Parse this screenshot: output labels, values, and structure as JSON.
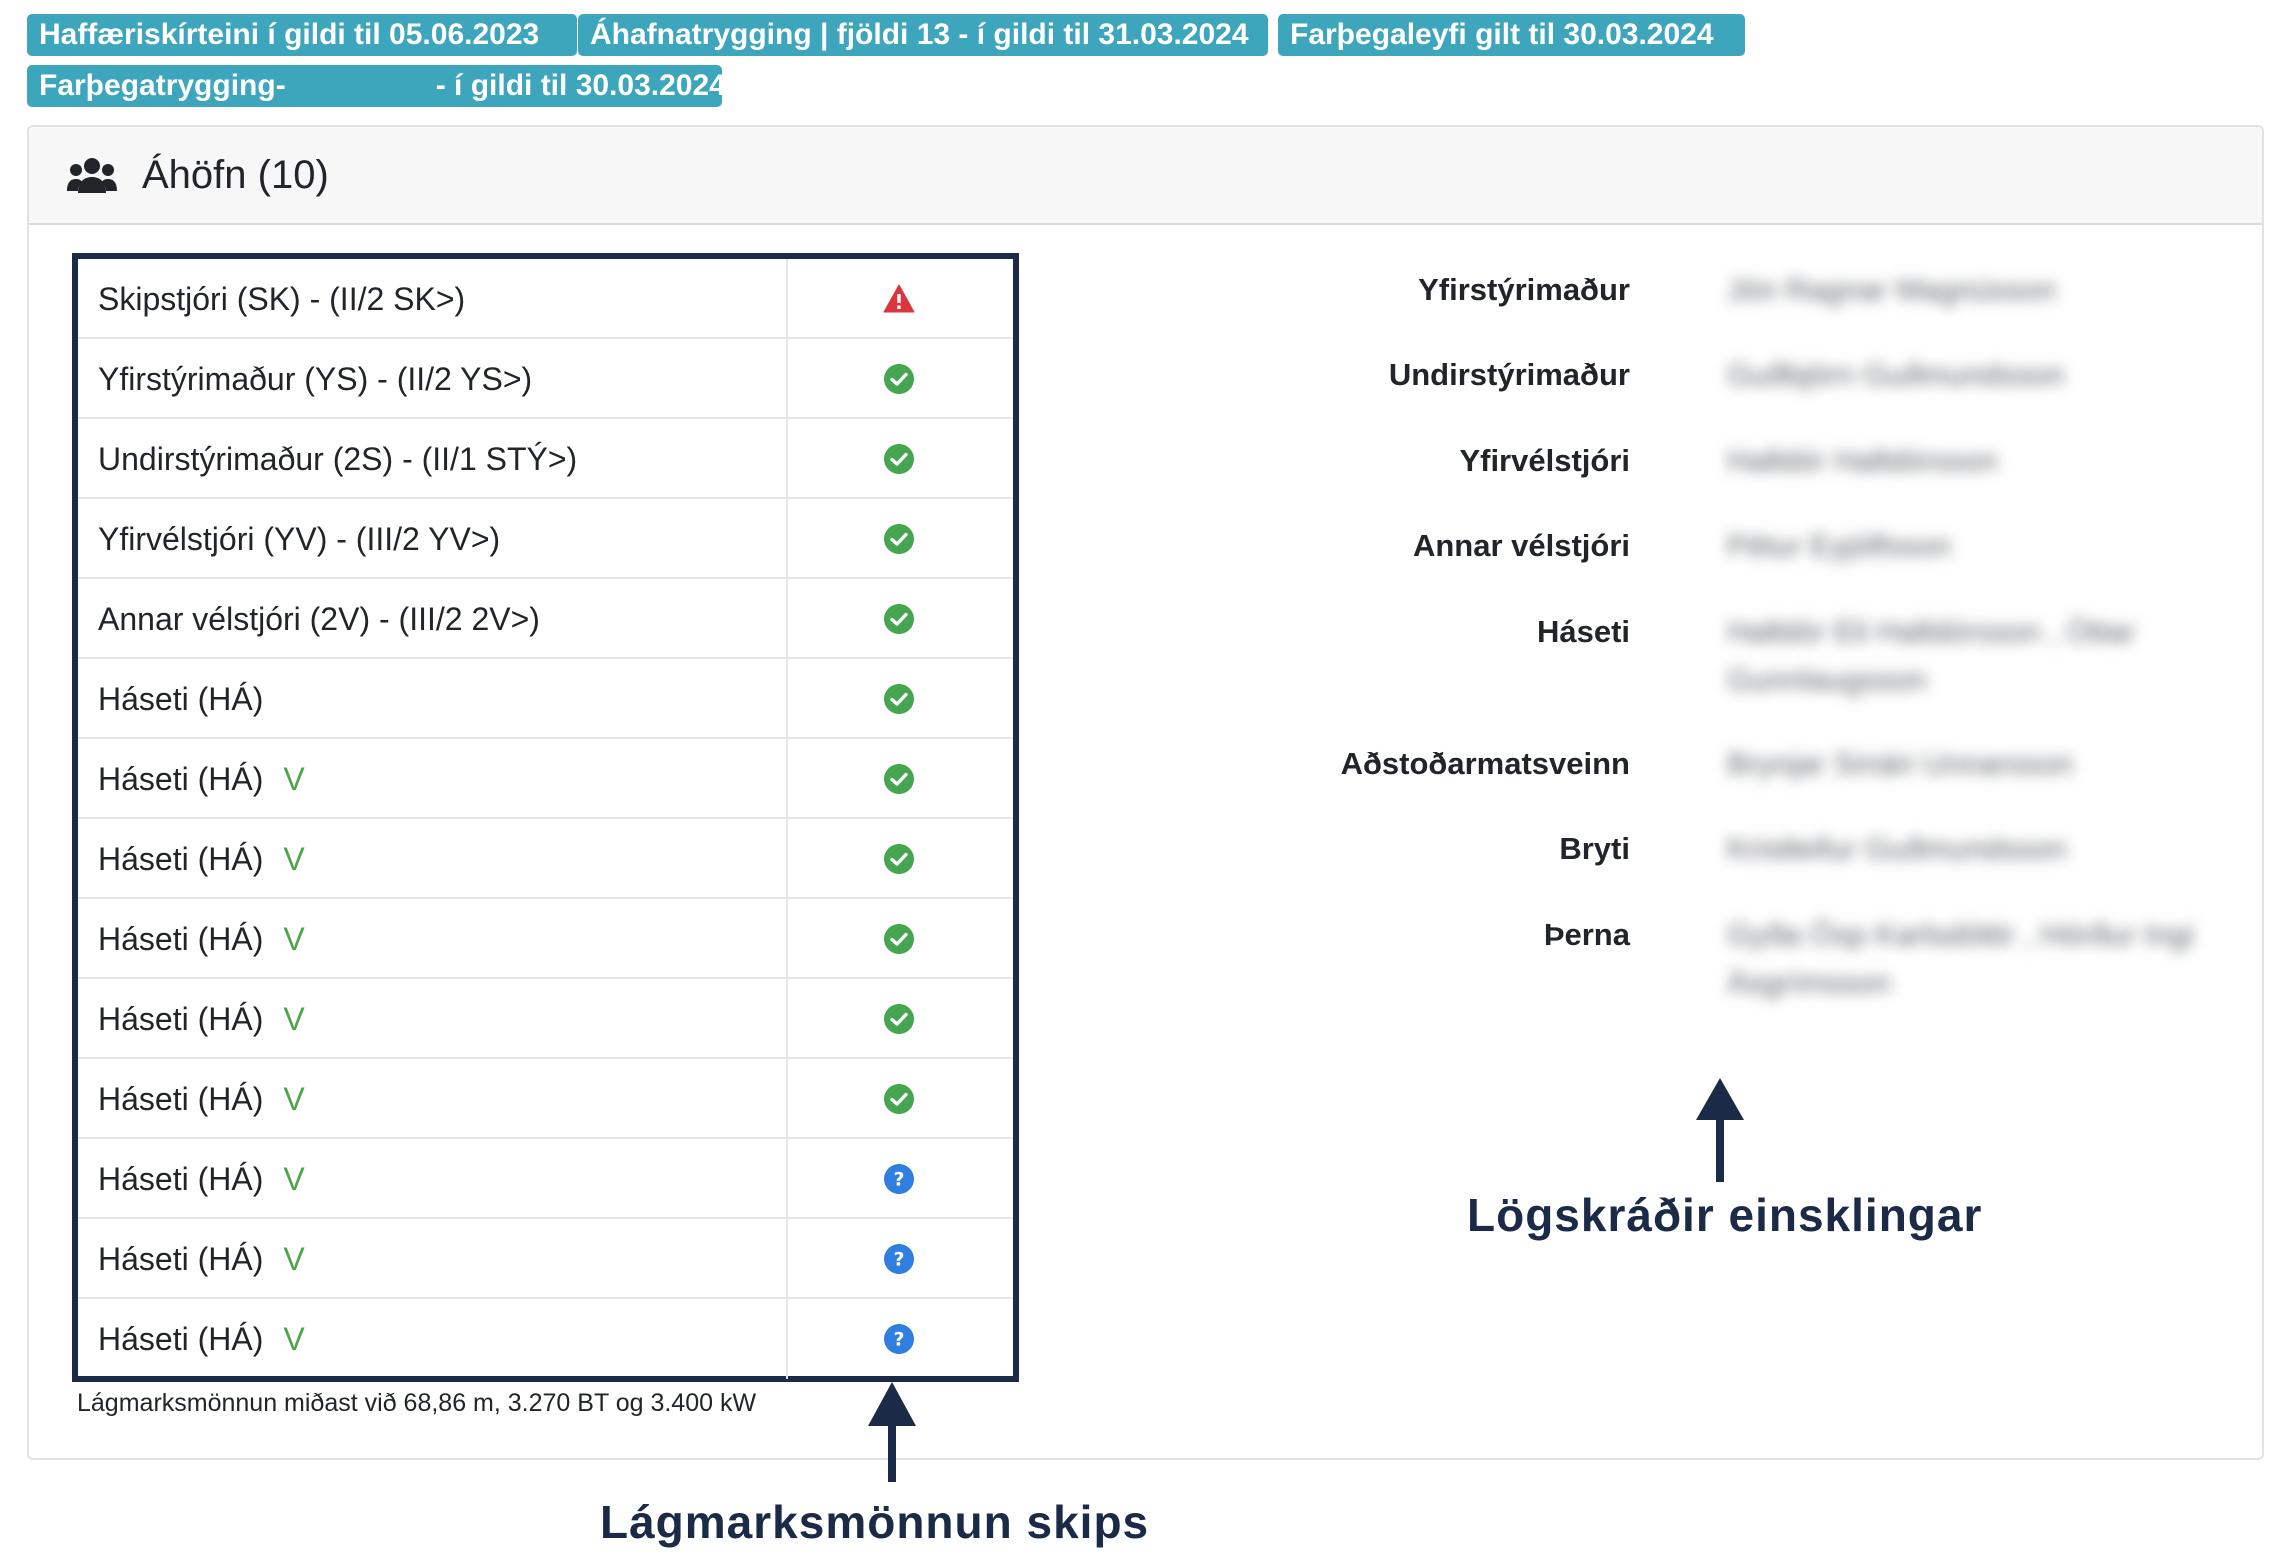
{
  "badges": [
    "Haffæriskírteini í gildi til 05.06.2023",
    "Áhafnatrygging | fjöldi 13 - í gildi til 31.03.2024",
    "Farþegaleyfi gilt til 30.03.2024",
    "Farþegatrygging-                  - í gildi til 30.03.2024"
  ],
  "card": {
    "title": "Áhöfn (10)",
    "icon": "users-icon"
  },
  "crew_table": {
    "rows": [
      {
        "label": "Skipstjóri (SK) - (II/2 SK>)",
        "mark": "",
        "status": "warning"
      },
      {
        "label": "Yfirstýrimaður (YS) - (II/2 YS>)",
        "mark": "",
        "status": "ok"
      },
      {
        "label": "Undirstýrimaður (2S) - (II/1 STÝ>)",
        "mark": "",
        "status": "ok"
      },
      {
        "label": "Yfirvélstjóri (YV) - (III/2 YV>)",
        "mark": "",
        "status": "ok"
      },
      {
        "label": "Annar vélstjóri (2V) - (III/2 2V>)",
        "mark": "",
        "status": "ok"
      },
      {
        "label": "Háseti (HÁ)",
        "mark": "",
        "status": "ok"
      },
      {
        "label": "Háseti (HÁ)",
        "mark": "V",
        "status": "ok"
      },
      {
        "label": "Háseti (HÁ)",
        "mark": "V",
        "status": "ok"
      },
      {
        "label": "Háseti (HÁ)",
        "mark": "V",
        "status": "ok"
      },
      {
        "label": "Háseti (HÁ)",
        "mark": "V",
        "status": "ok"
      },
      {
        "label": "Háseti (HÁ)",
        "mark": "V",
        "status": "ok"
      },
      {
        "label": "Háseti (HÁ)",
        "mark": "V",
        "status": "unknown"
      },
      {
        "label": "Háseti (HÁ)",
        "mark": "V",
        "status": "unknown"
      },
      {
        "label": "Háseti (HÁ)",
        "mark": "V",
        "status": "unknown"
      }
    ],
    "status_colors": {
      "warning": "#d9363e",
      "ok": "#45a550",
      "unknown": "#2f7fe0"
    },
    "footnote": "Lágmarksmönnun miðast við 68,86 m, 3.270 BT og 3.400 kW"
  },
  "registered": [
    {
      "role": "Yfirstýrimaður",
      "name": "Jón Ragnar Magnússon"
    },
    {
      "role": "Undirstýrimaður",
      "name": "Guðbjörn Guðmundsson"
    },
    {
      "role": "Yfirvélstjóri",
      "name": "Halldór Halldórsson"
    },
    {
      "role": "Annar vélstjóri",
      "name": "Pétur Eyjólfsson"
    },
    {
      "role": "Háseti",
      "name": "Halldór Eli Halldórsson , Óttar Gunnlaugsson"
    },
    {
      "role": "Aðstoðarmatsveinn",
      "name": "Brynjar Smári Unnarsson"
    },
    {
      "role": "Bryti",
      "name": "Kristleifur Guðmundsson"
    },
    {
      "role": "Þerna",
      "name": "Gyða Ösp Karlsdóttir , Hörður Ingi Ásgrímsson"
    }
  ],
  "callouts": {
    "right": "Lögskráðir einsklingar",
    "bottom": "Lágmarksmönnun skips"
  }
}
